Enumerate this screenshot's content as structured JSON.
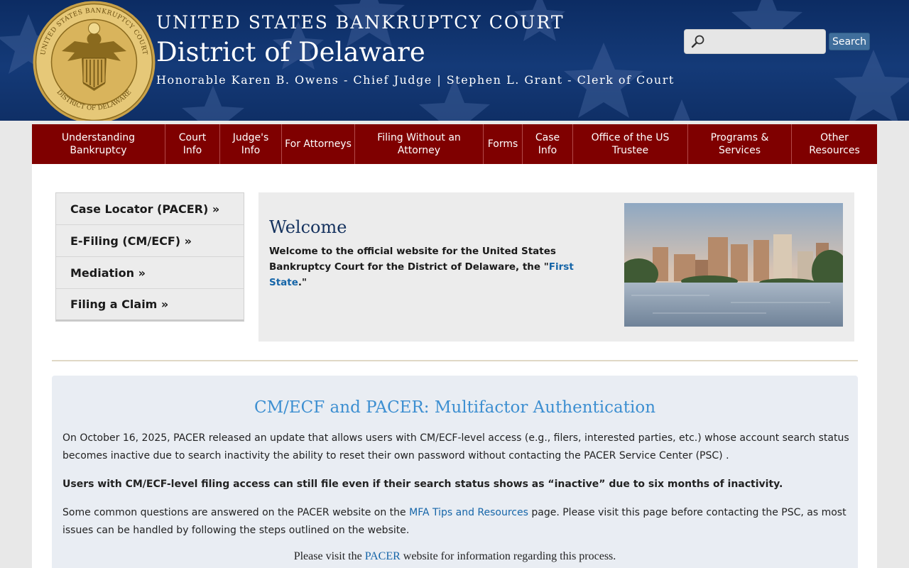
{
  "header": {
    "seal_alt": "UNITED STATES BANKRUPTCY COURT · DISTRICT OF DELAWARE",
    "court_name": "UNITED STATES BANKRUPTCY COURT",
    "district": "District of Delaware",
    "judges": "Honorable Karen B. Owens - Chief Judge | Stephen L. Grant - Clerk of Court",
    "search_placeholder": "",
    "search_button": "Search",
    "search_icon": "search-icon"
  },
  "nav": {
    "items": [
      {
        "label": "Understanding Bankruptcy"
      },
      {
        "label": "Court Info"
      },
      {
        "label": "Judge's Info"
      },
      {
        "label": "For Attorneys"
      },
      {
        "label": "Filing Without an Attorney"
      },
      {
        "label": "Forms"
      },
      {
        "label": "Case Info"
      },
      {
        "label": "Office of the US Trustee"
      },
      {
        "label": "Programs & Services"
      },
      {
        "label": "Other Resources"
      }
    ]
  },
  "sidebar": {
    "items": [
      {
        "label": "Case Locator (PACER) »"
      },
      {
        "label": "E-Filing (CM/ECF) »"
      },
      {
        "label": "Mediation »"
      },
      {
        "label": "Filing a Claim »"
      }
    ]
  },
  "welcome": {
    "title": "Welcome",
    "text_before": "Welcome to the official website for the United States Bankruptcy Court for the District of Delaware, the \"",
    "link": "First State",
    "text_after": ".\""
  },
  "notice": {
    "title": "CM/ECF and PACER: Multifactor Authentication",
    "p1": "On October 16, 2025, PACER released an update that allows users with CM/ECF-level access (e.g., filers, interested parties, etc.) whose account search status becomes inactive due to search inactivity the ability to reset their own password without contacting the PACER Service Center (PSC) .",
    "p2": "Users with CM/ECF-level filing access can still file even if their search status shows as “inactive” due to six months of inactivity.",
    "p3_before": "Some common questions are answered on the PACER website on the ",
    "p3_link": "MFA Tips and Resources",
    "p3_after": " page. Please visit this page before contacting the PSC, as most issues can be handled by following the steps outlined on the website.",
    "p4_before": "Please visit the ",
    "p4_link": "PACER",
    "p4_after": " website for information regarding this process."
  },
  "colors": {
    "header_blue": "#0c2c63",
    "nav_red": "#7f0000",
    "link_blue": "#1565a8",
    "notice_title": "#3d8fd1"
  }
}
